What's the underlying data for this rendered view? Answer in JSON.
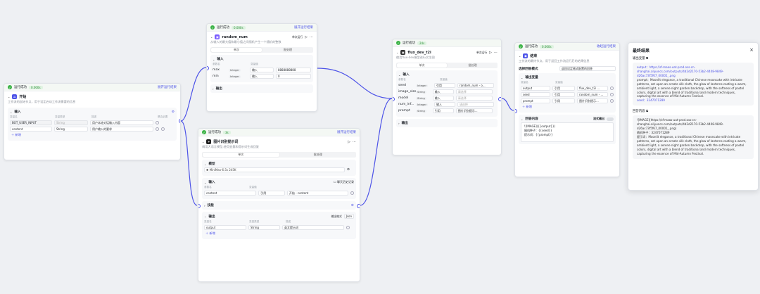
{
  "status": {
    "success": "运行成功",
    "expand": "展开运行结果",
    "expand2": "收起运行结果"
  },
  "start": {
    "time": "0.000s",
    "title": "开始",
    "desc": "工作流的起始节点，用于设定启动工作流需要的信息",
    "section": "输入",
    "cols": [
      "变量名",
      "变量类型",
      "描述",
      "是否必要"
    ],
    "rows": [
      {
        "name": "BOT_USER_INPUT",
        "type": "String",
        "desc": "用户本轮对话输入内容"
      },
      {
        "name": "content",
        "type": "String",
        "desc": "用户输入的要求"
      }
    ],
    "add": "新增"
  },
  "random": {
    "time": "0.000s",
    "title": "random_num",
    "mode": "单次运行",
    "desc": "从输入的最大值和最小值之间随机产生一个随机的整数",
    "tabs": [
      "单次",
      "批处理"
    ],
    "section": "输入",
    "cols": [
      "参数名",
      "变量值"
    ],
    "rows": [
      {
        "name": "max",
        "type": "Integer",
        "src": "输入",
        "val": "8888888888"
      },
      {
        "name": "min",
        "type": "Integer",
        "src": "输入",
        "val": "0"
      }
    ],
    "output": "输出"
  },
  "llm": {
    "time": "3s",
    "title": "图片识别提示词",
    "desc": "调用大语言模型,使用变量和提示词生成回复",
    "tabs": [
      "单次",
      "批处理"
    ],
    "model_section": "模型",
    "model": "MiniMax-6.5s 245K",
    "input_section": "输入",
    "chat_history": "聊天历史记录",
    "rows": [
      {
        "name": "content",
        "src": "引用",
        "val": "开始 - content"
      }
    ],
    "skill": "技能",
    "output_section": "输出",
    "format_label": "输出格式",
    "format": "Json",
    "out_rows": [
      {
        "name": "output",
        "type": "String",
        "desc": "英文提示词"
      }
    ],
    "add": "新增"
  },
  "flux": {
    "time": "24s",
    "title": "flux_dev_t2i",
    "mode": "单次运行",
    "desc": "使用flux-dev模型进行文生图",
    "tabs": [
      "单次",
      "批处理"
    ],
    "section": "输入",
    "cols": [
      "参数名",
      "变量值"
    ],
    "rows": [
      {
        "name": "seed",
        "type": "Integer",
        "src": "引用",
        "val": "random_num - o..."
      },
      {
        "name": "image_size",
        "type": "String",
        "src": "输入",
        "val": "请选择"
      },
      {
        "name": "model",
        "type": "String",
        "src": "输入",
        "val": "请选择"
      },
      {
        "name": "num_inf...",
        "type": "Integer",
        "src": "输入",
        "val": "请选择"
      },
      {
        "name": "prompt",
        "type": "String",
        "src": "引用",
        "val": "图片识别提示..."
      }
    ],
    "output": "输出"
  },
  "end": {
    "time": "0.000s",
    "title": "结束",
    "desc": "工作流的最终节点，用于返回工作流运行后的结果信息",
    "mode_label": "选择回答模式",
    "mode": "返回设定格式配置的回答",
    "out_section": "输出变量",
    "cols": [
      "变量名",
      "变量值"
    ],
    "rows": [
      {
        "name": "output",
        "src": "引用",
        "val": "flux_dev_t2i ..."
      },
      {
        "name": "seed",
        "src": "引用",
        "val": "random_num - ..."
      },
      {
        "name": "prompt",
        "src": "引用",
        "val": "图片识别提示..."
      }
    ],
    "add": "新增",
    "content_section": "回答内容",
    "stream": "流式输出",
    "template": [
      "![IMAGE]({{output}})",
      "随机种子：{{seed}}",
      "提示词：{{prompt}}"
    ]
  },
  "panel": {
    "title": "最终结果",
    "var_label": "输出变量",
    "var_lines": [
      "output：https://sf-maas-uat-prod.oss-cn-shanghai.aliyuncs.com/outputs/4d2d2170-53b2-4408-9849-d26ac73f5f67_00001_.png",
      "prompt：Moonlit elegance, a traditional Chinese mooncake with intricate patterns, set upon an ornate silk cloth, the glow of lanterns casting a warm, ambient light, a serene night garden backdrop, with the softness of pastel colors, digital art with a blend of traditional and modern techniques, capturing the essence of Mid-Autumn Festival.",
      "seed：3247071289"
    ],
    "ans_label": "回答内容",
    "ans_lines": [
      "![IMAGE](https://sf-maas-uat-prod.oss-cn-shanghai.aliyuncs.com/outputs/4d2d2170-53b2-4408-9849-d26ac73f5f67_00001_.png)",
      "随机种子：3247071289",
      "提示词：Moonlit elegance, a traditional Chinese mooncake with intricate patterns, set upon an ornate silk cloth, the glow of lanterns casting a warm, ambient light, a serene night garden backdrop, with the softness of pastel colors, digital art with a blend of traditional and modern techniques, capturing the essence of Mid-Autumn Festival."
    ],
    "close": "×"
  }
}
